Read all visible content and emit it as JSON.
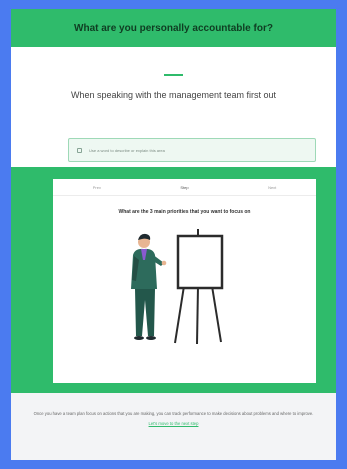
{
  "header": {
    "title": "What are you personally accountable for?"
  },
  "intro": {
    "prompt": "When speaking with the management team first out",
    "answer_placeholder": "Use a word to describe or explain this area"
  },
  "panel": {
    "tabs": [
      "Prev",
      "Step",
      "Next"
    ],
    "question": "What are the 3 main priorities that you want to focus on"
  },
  "footer": {
    "text": "Once you have a team plan focus on actions that you are making, you can track performance to make decisions about problems and where to improve.",
    "link": "Let's move to the next step"
  },
  "colors": {
    "brand_blue": "#4b7bf0",
    "accent_green": "#2fbb6b",
    "header_text": "#0f3d22"
  },
  "icons": {
    "illustration": "presenter-with-easel-illustration"
  }
}
